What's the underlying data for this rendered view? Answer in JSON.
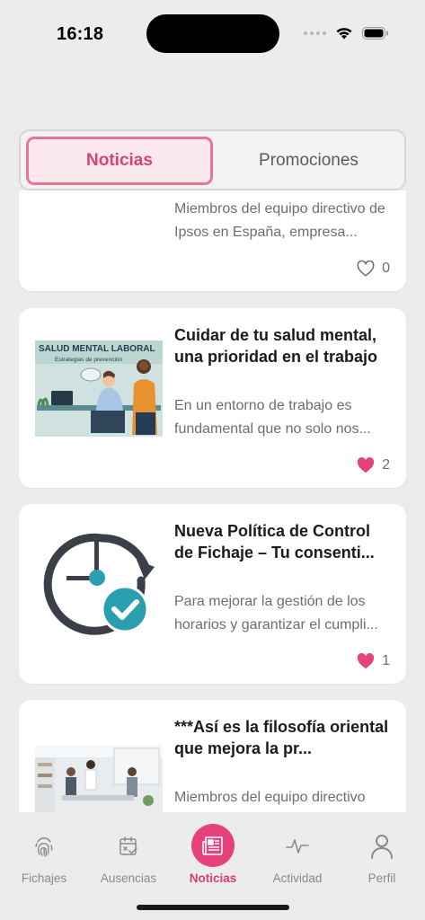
{
  "status_bar": {
    "time": "16:18"
  },
  "tabs": {
    "active": "Noticias",
    "inactive": "Promociones"
  },
  "news": [
    {
      "title": "",
      "description": "Miembros del equipo directivo de Ipsos en España, empresa...",
      "likes": "0",
      "liked": false
    },
    {
      "title": "Cuidar de tu salud mental, una prioridad en el trabajo",
      "description": "En un entorno de trabajo es fundamental que no solo nos...",
      "likes": "2",
      "liked": true,
      "image_title": "SALUD MENTAL LABORAL",
      "image_subtitle": "Estrategias de prevención"
    },
    {
      "title": "Nueva Política de Control de Fichaje – Tu consenti...",
      "description": "Para mejorar la gestión de los horarios y garantizar el cumpli...",
      "likes": "1",
      "liked": true
    },
    {
      "title": "***Así es la filosofía oriental que mejora la pr...",
      "description": "Miembros del equipo directivo",
      "likes": "",
      "liked": false
    }
  ],
  "bottom_nav": [
    {
      "label": "Fichajes",
      "icon": "fingerprint-icon"
    },
    {
      "label": "Ausencias",
      "icon": "calendar-check-icon"
    },
    {
      "label": "Noticias",
      "icon": "newspaper-icon",
      "active": true
    },
    {
      "label": "Actividad",
      "icon": "activity-pulse-icon"
    },
    {
      "label": "Perfil",
      "icon": "user-icon"
    }
  ],
  "colors": {
    "accent": "#e6417a",
    "heart": "#e6417a",
    "background": "#ececec"
  }
}
